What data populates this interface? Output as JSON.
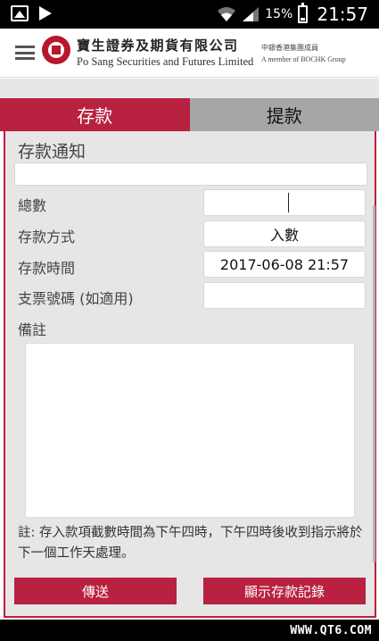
{
  "status_bar": {
    "battery_percent": "15%",
    "time": "21:57",
    "icons": [
      "gallery-icon",
      "play-store-icon",
      "wifi-icon",
      "signal-icon",
      "battery-icon"
    ]
  },
  "header": {
    "menu_icon": "hamburger-menu-icon",
    "brand_cn": "寶生證券及期貨有限公司",
    "brand_en": "Po Sang Securities and Futures Limited",
    "member_cn": "中銀香港集團成員",
    "member_en": "A member of BOCHK Group",
    "brand_color": "#b8162f"
  },
  "tabs": [
    {
      "label": "存款",
      "active": true
    },
    {
      "label": "提款",
      "active": false
    }
  ],
  "form": {
    "section_title": "存款通知",
    "title_value": "",
    "fields": {
      "amount_label": "總數",
      "amount_value": "",
      "method_label": "存款方式",
      "method_value": "入數",
      "time_label": "存款時間",
      "time_value": "2017-06-08 21:57",
      "cheque_label": "支票號碼 (如適用)",
      "cheque_value": ""
    },
    "remark_label": "備註",
    "remark_value": "",
    "note": "註: 存入款項截數時間為下午四時，下午四時後收到指示將於下一個工作天處理。",
    "send_button": "傳送",
    "records_button": "顯示存款記錄",
    "accent_color": "#b8213f"
  },
  "watermark": "WWW.QT6.COM"
}
